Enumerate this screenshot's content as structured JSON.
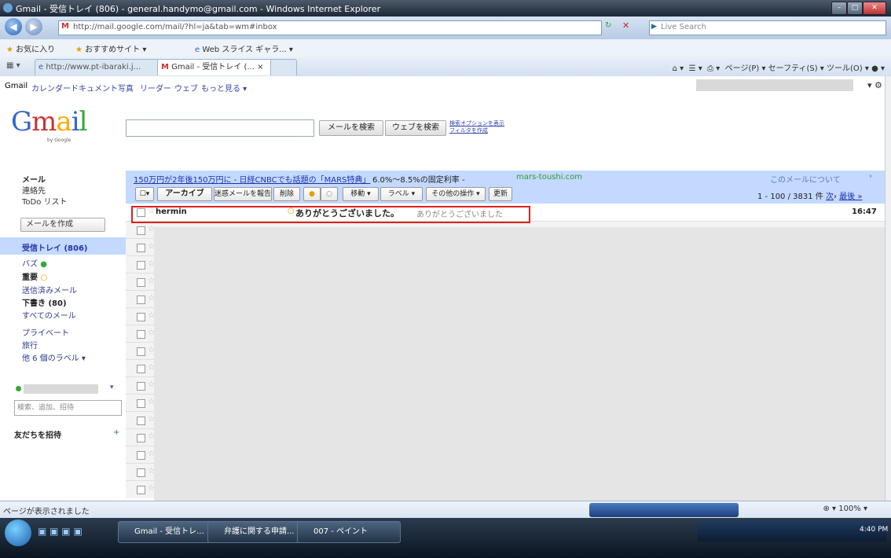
{
  "window": {
    "title": "Gmail - 受信トレイ (806) - general.handymo@gmail.com - Windows Internet Explorer"
  },
  "browser": {
    "address_prefix": "M",
    "address": "http://mail.google.com/mail/?hl=ja&tab=wm#inbox",
    "search_placeholder": "Live Search",
    "favorites_label": "お気に入り",
    "favorites_items": [
      "おすすめサイト ▾",
      "Web スライス ギャラ... ▾"
    ],
    "tabs": [
      "http://www.pt-ibaraki.j...",
      "Gmail - 受信トレイ (... ×"
    ],
    "tools": "ページ(P) ▾ セーフティ(S) ▾ ツール(O) ▾"
  },
  "gbar": {
    "brand": "Gmail",
    "links": [
      "カレンダー",
      "ドキュメント",
      "写真",
      "リーダー",
      "ウェブ",
      "もっと見る ▾"
    ]
  },
  "logo": {
    "letters": [
      "G",
      "m",
      "a",
      "i",
      "l"
    ],
    "sub": "by Google"
  },
  "search": {
    "mail_button": "メールを検索",
    "web_button": "ウェブを検索",
    "options_link": "検索オプションを表示",
    "filter_link": "フィルタを作成"
  },
  "sidebar": {
    "mail": "メール",
    "contacts": "連絡先",
    "todo": "ToDo リスト",
    "compose": "メールを作成",
    "items": [
      {
        "label": "受信トレイ (806)"
      },
      {
        "label": "バズ"
      },
      {
        "label": "重要"
      },
      {
        "label": "送信済みメール"
      },
      {
        "label": "下書き (80)"
      },
      {
        "label": "すべてのメール"
      },
      {
        "label": "プライベート"
      },
      {
        "label": "旅行"
      },
      {
        "label": "他 6 個のラベル ▾"
      }
    ],
    "chat_search_placeholder": "検索、追加、招待",
    "invite": "友だちを招待"
  },
  "ad": {
    "link": "150万円が2年後150万円に - 日経CNBCでも話題の「MARS特典」",
    "text": "6.0%～8.5%の固定利率 -",
    "url": "mars-toushi.com",
    "right": "このメールについて",
    "close": "›"
  },
  "toolbar": {
    "archive": "アーカイブ",
    "spam": "迷惑メールを報告",
    "delete": "削除",
    "move": "移動 ▾",
    "labels": "ラベル ▾",
    "more": "その他の操作 ▾",
    "refresh": "更新",
    "pager_count": "1 - 100 / 3831 件",
    "pager_next": "次",
    "pager_last": "最後 »"
  },
  "messages": [
    {
      "sender": "hermin",
      "subject": "ありがとうございました。",
      "snippet": "ありがとうございました",
      "time": "16:47"
    }
  ],
  "status": {
    "text": "ページが表示されました",
    "zoom": "100%"
  },
  "taskbar": {
    "tasks": [
      "Gmail - 受信トレ...",
      "弁護に関する申請...",
      "007 - ペイント"
    ],
    "clock": "4:40 PM"
  }
}
